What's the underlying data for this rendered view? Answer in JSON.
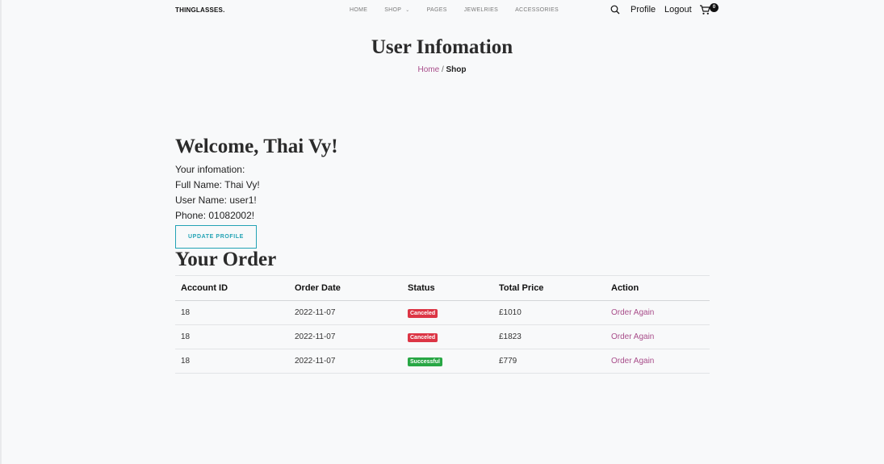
{
  "nav": {
    "brand": "THINGLASSES.",
    "menu": [
      "HOME",
      "SHOP",
      "PAGES",
      "JEWELRIES",
      "ACCESSORIES"
    ],
    "profile": "Profile",
    "logout": "Logout",
    "cart_count": "0"
  },
  "hero": {
    "title": "User Infomation",
    "breadcrumb_home": "Home",
    "breadcrumb_sep": " / ",
    "breadcrumb_current": "Shop"
  },
  "profile": {
    "welcome": "Welcome, Thai Vy!",
    "heading": "Your infomation:",
    "full_name": "Full Name: Thai Vy!",
    "user_name": "User Name: user1!",
    "phone": "Phone: 01082002!",
    "update_label": "UPDATE PROFILE"
  },
  "orders": {
    "title": "Your Order",
    "headers": [
      "Account ID",
      "Order Date",
      "Status",
      "Total Price",
      "Action"
    ],
    "rows": [
      {
        "account_id": "18",
        "date": "2022-11-07",
        "status": "Canceled",
        "price": "£1010",
        "action": "Order Again"
      },
      {
        "account_id": "18",
        "date": "2022-11-07",
        "status": "Canceled",
        "price": "£1823",
        "action": "Order Again"
      },
      {
        "account_id": "18",
        "date": "2022-11-07",
        "status": "Successful",
        "price": "£779",
        "action": "Order Again"
      }
    ]
  },
  "colors": {
    "accent": "#a84d8a",
    "button": "#23a3b5",
    "canceled": "#dc3545",
    "successful": "#28a745"
  },
  "icons": [
    "search-icon",
    "cart-icon",
    "chevron-down-icon"
  ]
}
